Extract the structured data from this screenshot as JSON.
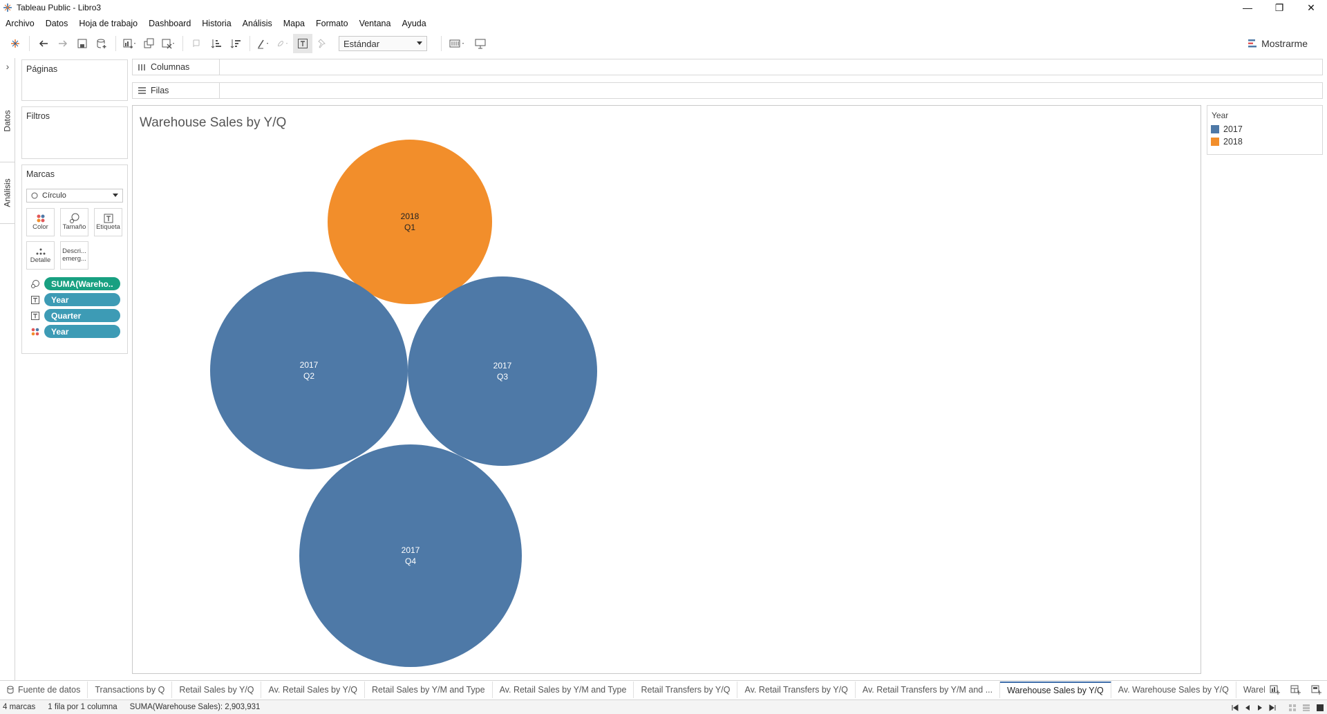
{
  "window": {
    "title": "Tableau Public - Libro3",
    "minimize": "—",
    "restore": "❐",
    "close": "✕"
  },
  "menu": [
    "Archivo",
    "Datos",
    "Hoja de trabajo",
    "Dashboard",
    "Historia",
    "Análisis",
    "Mapa",
    "Formato",
    "Ventana",
    "Ayuda"
  ],
  "toolbar": {
    "fit_select": "Estándar",
    "show_me": "Mostrarme"
  },
  "side_tabs": {
    "data": "Datos",
    "analysis": "Análisis",
    "expand": "›"
  },
  "cards": {
    "pages": "Páginas",
    "filters": "Filtros",
    "marks": "Marcas",
    "mark_type": "Círculo"
  },
  "mark_buttons": {
    "color": "Color",
    "size": "Tamaño",
    "label": "Etiqueta",
    "detail": "Detalle",
    "tooltip": "Descri... emerg..."
  },
  "pills": [
    {
      "label": "SUMA(Wareho..",
      "color": "#18a081",
      "icon": "size-icon"
    },
    {
      "label": "Year",
      "color": "#3d9bb5",
      "icon": "label-icon"
    },
    {
      "label": "Quarter",
      "color": "#3d9bb5",
      "icon": "label-icon"
    },
    {
      "label": "Year",
      "color": "#3d9bb5",
      "icon": "color-icon"
    }
  ],
  "shelves": {
    "columns": "Columnas",
    "rows": "Filas"
  },
  "viz": {
    "title": "Warehouse Sales by Y/Q"
  },
  "legend": {
    "title": "Year",
    "items": [
      {
        "label": "2017",
        "color": "#4e79a7"
      },
      {
        "label": "2018",
        "color": "#f28e2b"
      }
    ]
  },
  "chart_data": {
    "type": "packed-bubble",
    "title": "Warehouse Sales by Y/Q",
    "size_measure": "SUMA(Warehouse Sales)",
    "color_field": "Year",
    "label_fields": [
      "Year",
      "Quarter"
    ],
    "colors": {
      "2017": "#4e79a7",
      "2018": "#f28e2b"
    },
    "bubbles": [
      {
        "year": "2018",
        "quarter": "Q1"
      },
      {
        "year": "2017",
        "quarter": "Q2"
      },
      {
        "year": "2017",
        "quarter": "Q3"
      },
      {
        "year": "2017",
        "quarter": "Q4"
      }
    ],
    "total": "2,903,931"
  },
  "sheet_tabs": [
    {
      "label": "Fuente de datos",
      "active": false
    },
    {
      "label": "Transactions by Q",
      "active": false
    },
    {
      "label": "Retail Sales by Y/Q",
      "active": false
    },
    {
      "label": "Av. Retail Sales by Y/Q",
      "active": false
    },
    {
      "label": "Retail Sales by Y/M and Type",
      "active": false
    },
    {
      "label": "Av. Retail Sales by Y/M and Type",
      "active": false
    },
    {
      "label": "Retail Transfers by Y/Q",
      "active": false
    },
    {
      "label": "Av. Retail Transfers by Y/Q",
      "active": false
    },
    {
      "label": "Av. Retail Transfers by Y/M and ...",
      "active": false
    },
    {
      "label": "Warehouse Sales by Y/Q",
      "active": true
    },
    {
      "label": "Av. Warehouse Sales by Y/Q",
      "active": false
    },
    {
      "label": "Warehouse",
      "active": false
    }
  ],
  "status": {
    "marks": "4 marcas",
    "rows_cols": "1 fila por 1 columna",
    "sum": "SUMA(Warehouse Sales): 2,903,931"
  }
}
